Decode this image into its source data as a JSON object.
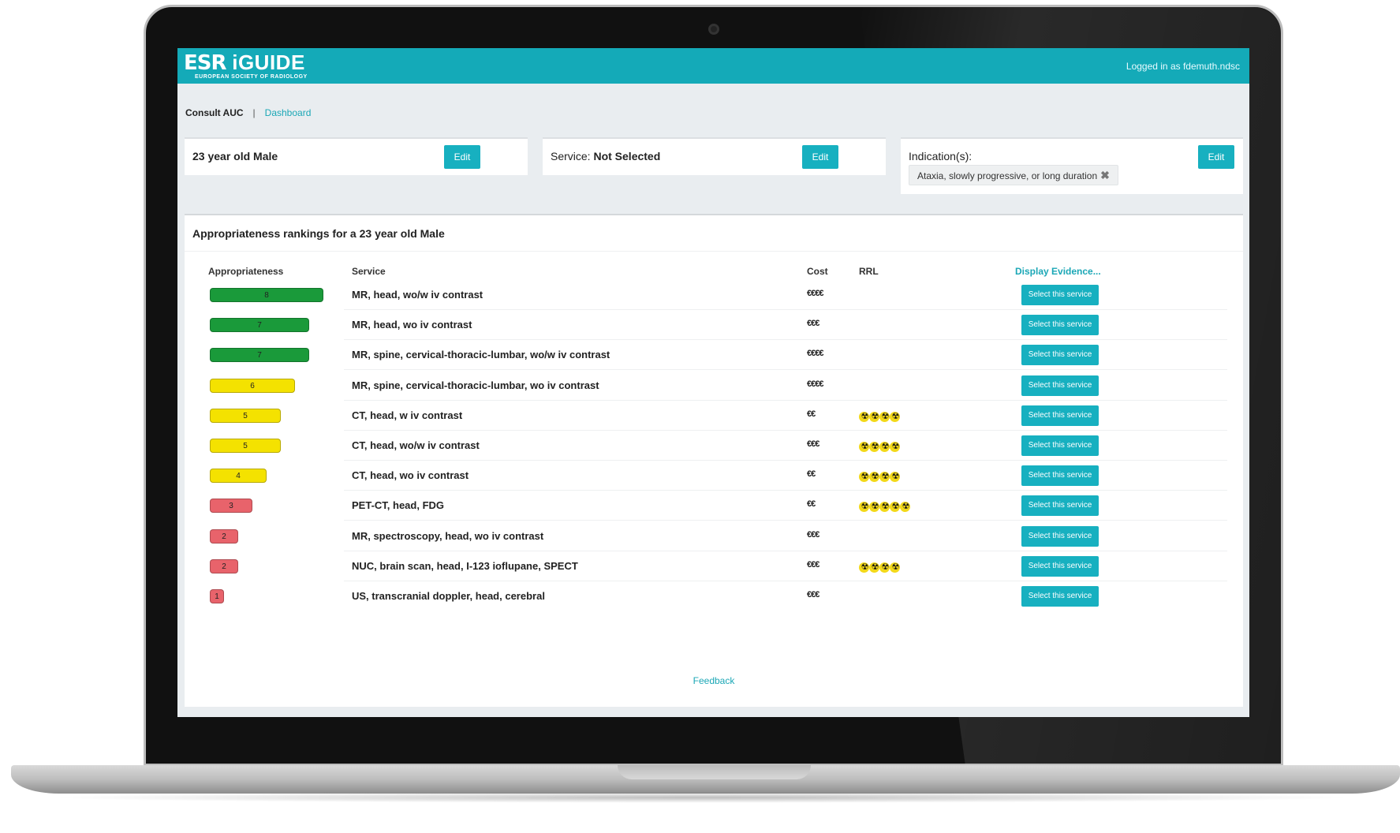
{
  "header": {
    "logo_main": "ESR",
    "logo_product": " iGUIDE",
    "logo_sub": "EUROPEAN SOCIETY OF RADIOLOGY",
    "login_text": "Logged in as fdemuth.ndsc"
  },
  "nav": {
    "current": "Consult AUC",
    "separator": "|",
    "dashboard": "Dashboard"
  },
  "cards": {
    "patient": {
      "text": "23 year old Male",
      "edit": "Edit"
    },
    "service": {
      "label": "Service:",
      "value": "Not Selected",
      "edit": "Edit"
    },
    "indication": {
      "label": "Indication(s):",
      "tag": "Ataxia, slowly progressive, or long duration",
      "edit": "Edit"
    }
  },
  "rankings": {
    "title": "Appropriateness rankings for a 23 year old Male",
    "columns": {
      "appropriateness": "Appropriateness",
      "service": "Service",
      "cost": "Cost",
      "rrl": "RRL",
      "evidence": "Display Evidence..."
    },
    "select_label": "Select this service",
    "rows": [
      {
        "score": "8",
        "level": 8,
        "color": "#1a9a3a",
        "service": "MR, head, wo/w iv contrast",
        "cost": "€€€€",
        "rrl": 0
      },
      {
        "score": "7",
        "level": 7,
        "color": "#1a9a3a",
        "service": "MR, head, wo iv contrast",
        "cost": "€€€",
        "rrl": 0
      },
      {
        "score": "7",
        "level": 7,
        "color": "#1a9a3a",
        "service": "MR, spine, cervical-thoracic-lumbar, wo/w iv contrast",
        "cost": "€€€€",
        "rrl": 0
      },
      {
        "score": "6",
        "level": 6,
        "color": "#f4e200",
        "service": "MR, spine, cervical-thoracic-lumbar, wo iv contrast",
        "cost": "€€€€",
        "rrl": 0
      },
      {
        "score": "5",
        "level": 5,
        "color": "#f4e200",
        "service": "CT, head, w iv contrast",
        "cost": "€€",
        "rrl": 4
      },
      {
        "score": "5",
        "level": 5,
        "color": "#f4e200",
        "service": "CT, head, wo/w iv contrast",
        "cost": "€€€",
        "rrl": 4
      },
      {
        "score": "4",
        "level": 4,
        "color": "#f4e200",
        "service": "CT, head, wo iv contrast",
        "cost": "€€",
        "rrl": 4
      },
      {
        "score": "3",
        "level": 3,
        "color": "#e8636b",
        "service": "PET-CT, head, FDG",
        "cost": "€€",
        "rrl": 5
      },
      {
        "score": "2",
        "level": 2,
        "color": "#e8636b",
        "service": "MR, spectroscopy, head, wo iv contrast",
        "cost": "€€€",
        "rrl": 0
      },
      {
        "score": "2",
        "level": 2,
        "color": "#e8636b",
        "service": "NUC, brain scan, head, I-123 ioflupane, SPECT",
        "cost": "€€€",
        "rrl": 4
      },
      {
        "score": "1",
        "level": 1,
        "color": "#e8636b",
        "service": "US, transcranial doppler, head, cerebral",
        "cost": "€€€",
        "rrl": 0
      }
    ],
    "feedback": "Feedback"
  }
}
